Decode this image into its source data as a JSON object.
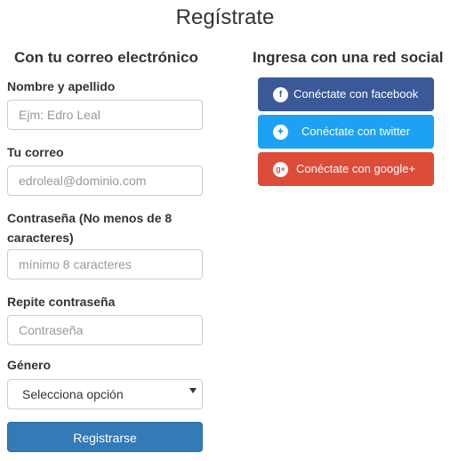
{
  "page": {
    "title": "Regístrate"
  },
  "left": {
    "heading": "Con tu correo electrónico",
    "fields": {
      "name": {
        "label": "Nombre y apellido",
        "placeholder": "Ejm: Edro Leal"
      },
      "email": {
        "label": "Tu correo",
        "placeholder": "edroleal@dominio.com"
      },
      "password": {
        "label": "Contraseña (No menos de 8 caracteres)",
        "placeholder": "mínimo 8 caracteres"
      },
      "confirm": {
        "label": "Repite contraseña",
        "placeholder": "Contraseña"
      },
      "gender": {
        "label": "Género",
        "selected": "Selecciona opción"
      }
    },
    "submit_label": "Registrarse"
  },
  "right": {
    "heading": "Ingresa con una red social",
    "buttons": [
      {
        "label": "Conéctate con facebook",
        "icon": "facebook-icon",
        "icon_glyph": "f",
        "color": "#3b5998"
      },
      {
        "label": "Conéctate con twitter",
        "icon": "twitter-icon",
        "icon_glyph": "✦",
        "color": "#1da1f2"
      },
      {
        "label": "Conéctate con google+",
        "icon": "google-plus-icon",
        "icon_glyph": "g+",
        "color": "#dd4b39"
      }
    ]
  },
  "colors": {
    "primary": "#337ab7"
  }
}
